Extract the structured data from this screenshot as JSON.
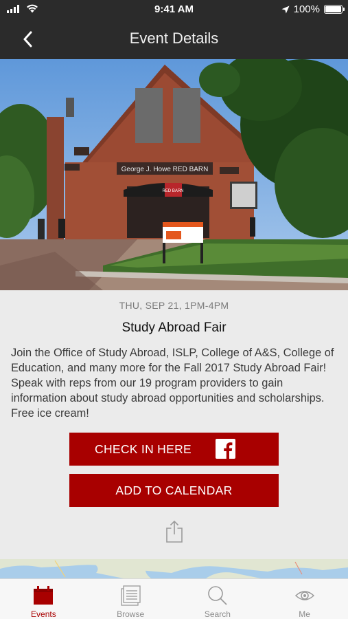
{
  "status_bar": {
    "time": "9:41 AM",
    "battery": "100%"
  },
  "nav": {
    "title": "Event Details"
  },
  "event": {
    "date": "THU, SEP 21, 1PM-4PM",
    "title": "Study Abroad Fair",
    "description": "Join the Office of Study Abroad, ISLP, College of A&S, College of Education, and many more for the Fall 2017 Study Abroad Fair! Speak with reps from our 19 program providers to gain information about study abroad opportunities and scholarships. Free ice cream!"
  },
  "hero_photo": {
    "building_sign": "George J. Howe RED BARN",
    "red_sign": "RED BARN"
  },
  "actions": {
    "check_in_label": "CHECK IN HERE",
    "add_calendar_label": "ADD TO CALENDAR"
  },
  "tabs": [
    {
      "label": "Events",
      "icon": "calendar-icon",
      "active": true
    },
    {
      "label": "Browse",
      "icon": "list-icon",
      "active": false
    },
    {
      "label": "Search",
      "icon": "search-icon",
      "active": false
    },
    {
      "label": "Me",
      "icon": "eye-icon",
      "active": false
    }
  ],
  "colors": {
    "accent": "#a80000",
    "nav_background": "#2b2b2b",
    "body_background": "#ebebeb"
  }
}
